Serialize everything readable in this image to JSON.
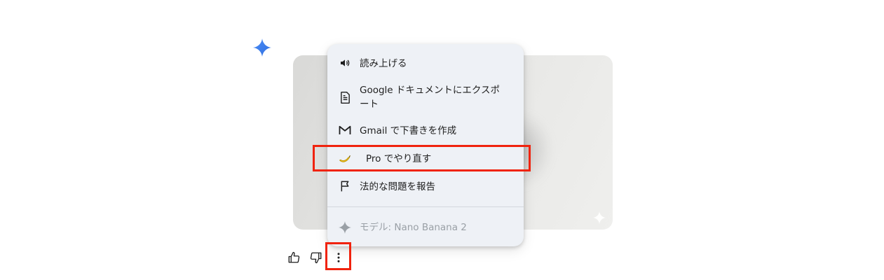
{
  "menu": {
    "items": [
      {
        "label": "読み上げる",
        "icon": "speaker-icon"
      },
      {
        "label": "Google ドキュメントにエクスポート",
        "icon": "document-icon"
      },
      {
        "label": "Gmail で下書きを作成",
        "icon": "gmail-icon"
      },
      {
        "label": "Pro でやり直す",
        "icon": "banana-icon"
      },
      {
        "label": "法的な問題を報告",
        "icon": "flag-icon"
      }
    ],
    "model_label": "モデル: Nano Banana 2"
  },
  "colors": {
    "highlight": "#f0230e",
    "gemini_blue": "#3b82f6",
    "menu_bg": "#eef1f6"
  },
  "actions": {
    "thumb_up": "thumb-up-icon",
    "thumb_down": "thumb-down-icon",
    "more": "more-vert-icon"
  }
}
